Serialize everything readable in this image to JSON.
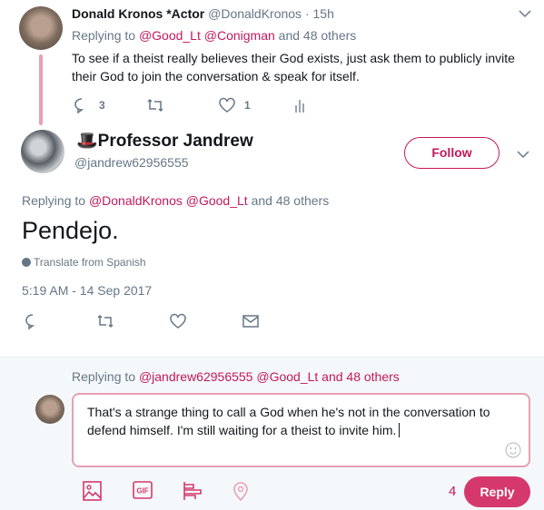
{
  "colors": {
    "accent": "#c2185b",
    "reply_button": "#d5386c",
    "thread_line": "#e8a0b4",
    "compose_bg": "#f5f8fa"
  },
  "parent_tweet": {
    "name": "Donald Kronos *Actor",
    "handle": "@DonaldKronos",
    "time": "· 15h",
    "replying_prefix": "Replying to",
    "mentions": "@Good_Lt @Conigman",
    "others": "and 48 others",
    "text": "To see if a theist really believes their God exists, just ask them to publicly invite their God to join the conversation & speak for itself.",
    "reply_count": "3",
    "like_count": "1"
  },
  "main_tweet": {
    "emoji": "🎩",
    "name": "Professor Jandrew",
    "handle": "@jandrew62956555",
    "follow_label": "Follow",
    "replying_prefix": "Replying to",
    "mentions": "@DonaldKronos @Good_Lt",
    "others": "and 48 others",
    "text": "Pendejo.",
    "translate": "Translate from Spanish",
    "timestamp": "5:19 AM - 14 Sep 2017"
  },
  "compose": {
    "replying_prefix": "Replying to",
    "mentions": "@jandrew62956555 @Good_Lt and 48 others",
    "text": "That's a strange thing to call a God when he's not in the conversation to defend himself. I'm still waiting for a theist to invite him.",
    "char_count": "4",
    "reply_label": "Reply",
    "icons": [
      "image-icon",
      "gif-icon",
      "poll-icon",
      "location-icon",
      "emoji-icon"
    ]
  }
}
